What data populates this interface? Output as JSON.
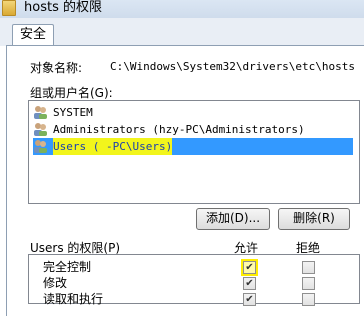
{
  "window": {
    "title": "hosts 的权限",
    "icon": "folder-icon"
  },
  "tabs": [
    {
      "label": "安全"
    }
  ],
  "object": {
    "label": "对象名称:",
    "value": "C:\\Windows\\System32\\drivers\\etc\\hosts"
  },
  "users": {
    "label": "组或用户名(G):",
    "items": [
      {
        "name": "SYSTEM",
        "icon": "user-group-icon"
      },
      {
        "name": "Administrators (hzy-PC\\Administrators)",
        "icon": "user-group-icon"
      },
      {
        "name": "Users (    -PC\\Users)",
        "icon": "user-group-icon",
        "selected": true
      }
    ]
  },
  "buttons": {
    "add": "添加(D)...",
    "remove": "删除(R)"
  },
  "permissions": {
    "header": "Users 的权限(P)",
    "allow_label": "允许",
    "deny_label": "拒绝",
    "rows": [
      {
        "name": "完全控制",
        "allow": true,
        "deny": false
      },
      {
        "name": "修改",
        "allow": true,
        "deny": false
      },
      {
        "name": "读取和执行",
        "allow": true,
        "deny": false
      }
    ]
  },
  "colors": {
    "selection": "#3399ff",
    "highlight": "#f2f51c"
  }
}
